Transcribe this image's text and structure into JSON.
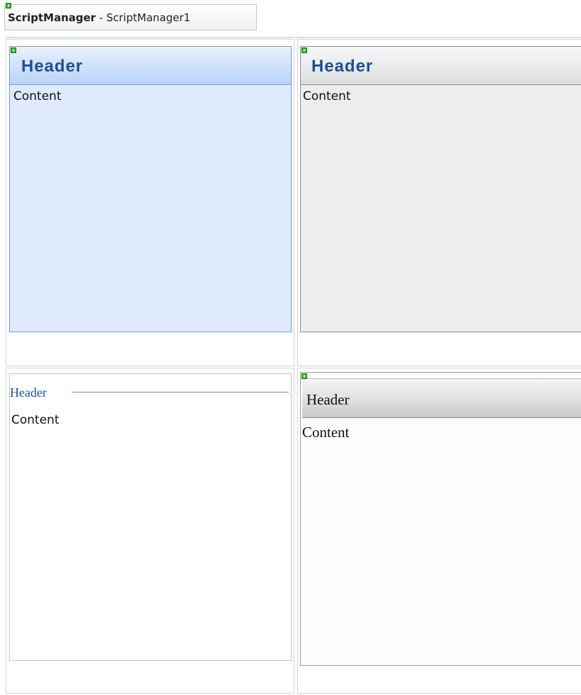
{
  "script_manager": {
    "type_label": "ScriptManager",
    "separator": " - ",
    "instance_name": "ScriptManager1"
  },
  "widgets": [
    {
      "skin": "blue",
      "header": "Header",
      "content": "Content"
    },
    {
      "skin": "silver",
      "header": "Header",
      "content": "Content"
    },
    {
      "skin": "fieldset",
      "header": "Header",
      "content": "Content"
    },
    {
      "skin": "gray",
      "header": "Header",
      "content": "Content"
    }
  ],
  "icons": {
    "smart_tag": "smart-tag-icon"
  },
  "colors": {
    "header_text_blue": "#1f4f94",
    "smart_tag_green": "#2fb82f",
    "blue_body": "#dfeafc",
    "silver_body": "#ecedef"
  }
}
